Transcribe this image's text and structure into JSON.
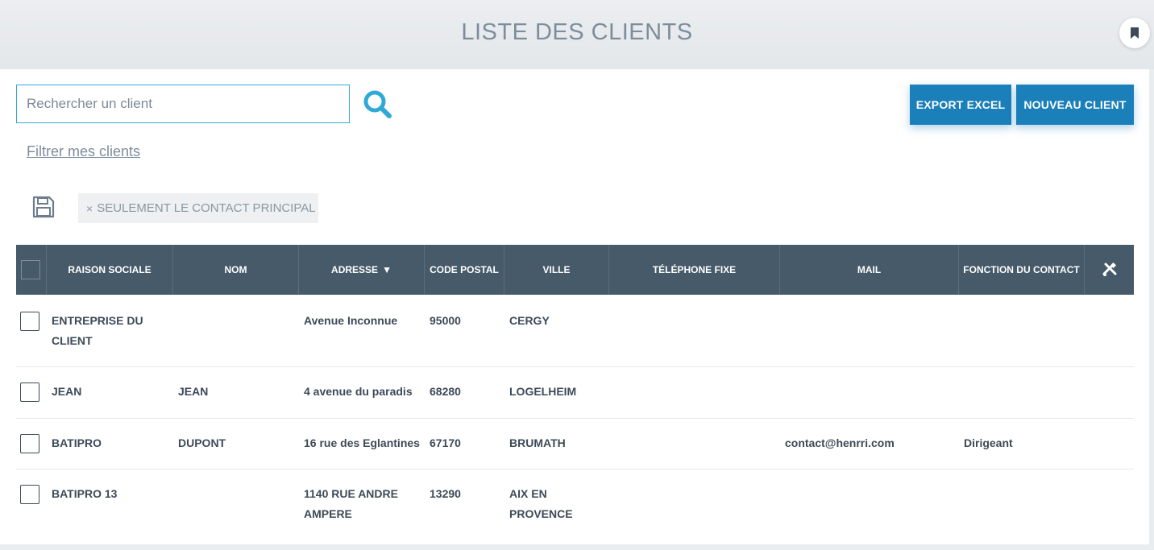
{
  "header": {
    "title": "LISTE DES CLIENTS"
  },
  "toolbar": {
    "search_placeholder": "Rechercher un client",
    "export_label": "EXPORT EXCEL",
    "new_label": "NOUVEAU CLIENT",
    "filter_link": "Filtrer mes clients",
    "chip_label": "SEULEMENT LE CONTACT PRINCIPAL",
    "chip_close": "×"
  },
  "table": {
    "columns": [
      "RAISON SOCIALE",
      "NOM",
      "ADRESSE",
      "CODE POSTAL",
      "VILLE",
      "TÉLÉPHONE FIXE",
      "MAIL",
      "FONCTION DU CONTACT"
    ],
    "sort_indicator": "▼",
    "rows": [
      {
        "raison": "ENTREPRISE DU CLIENT",
        "nom": "",
        "adresse": "Avenue Inconnue",
        "cp": "95000",
        "ville": "CERGY",
        "tel": "",
        "mail": "",
        "fonction": ""
      },
      {
        "raison": "JEAN",
        "nom": "JEAN",
        "adresse": "4 avenue du paradis",
        "cp": "68280",
        "ville": "LOGELHEIM",
        "tel": "",
        "mail": "",
        "fonction": ""
      },
      {
        "raison": "BATIPRO",
        "nom": "DUPONT",
        "adresse": "16 rue des Eglantines",
        "cp": "67170",
        "ville": "BRUMATH",
        "tel": "",
        "mail": "contact@henrri.com",
        "fonction": "Dirigeant"
      },
      {
        "raison": "BATIPRO 13",
        "nom": "",
        "adresse": "1140 RUE ANDRE AMPERE",
        "cp": "13290",
        "ville": "AIX EN PROVENCE",
        "tel": "",
        "mail": "",
        "fonction": ""
      }
    ]
  },
  "icons": {
    "search": "search-icon",
    "save": "save-icon",
    "bookmark": "bookmark-icon",
    "columns": "tools-icon"
  },
  "colors": {
    "accent": "#1b7fba",
    "search": "#31a9d6",
    "header_bg": "#465a69"
  }
}
